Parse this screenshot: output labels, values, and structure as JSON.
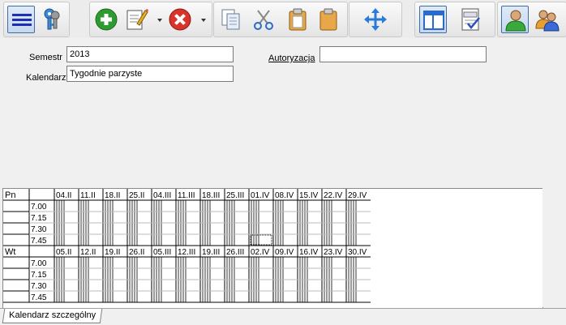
{
  "toolbar": {
    "icons": [
      "menu-icon",
      "keys-icon",
      "add-icon",
      "edit-icon",
      "delete-icon",
      "copy-icon",
      "cut-icon",
      "paste-icon",
      "paste-special-icon",
      "move-icon",
      "layout-icon",
      "report-icon",
      "user-icon",
      "users-icon"
    ],
    "accent_color": "#1c2fb5"
  },
  "form": {
    "semestr_label": "Semestr",
    "semestr_value": "2013",
    "kalendarz_label": "Kalendarz",
    "kalendarz_value": "Tygodnie parzyste",
    "autoryzacja_label": "Autoryzacja",
    "autoryzacja_value": ""
  },
  "calendar": {
    "sections": [
      {
        "day": "Pn",
        "times": [
          "7.00",
          "7.15",
          "7.30",
          "7.45"
        ],
        "dates": [
          "04.II",
          "11.II",
          "18.II",
          "25.II",
          "04.III",
          "11.III",
          "18.III",
          "25.III",
          "01.IV",
          "08.IV",
          "15.IV",
          "22.IV",
          "29.IV"
        ]
      },
      {
        "day": "Wt",
        "times": [
          "7.00",
          "7.15",
          "7.30",
          "7.45"
        ],
        "dates": [
          "05.II",
          "12.II",
          "19.II",
          "26.II",
          "05.III",
          "12.III",
          "19.III",
          "26.III",
          "02.IV",
          "09.IV",
          "16.IV",
          "23.IV",
          "30.IV"
        ]
      }
    ]
  },
  "tabs": [
    {
      "label": "Kalendarz szczególny"
    }
  ]
}
